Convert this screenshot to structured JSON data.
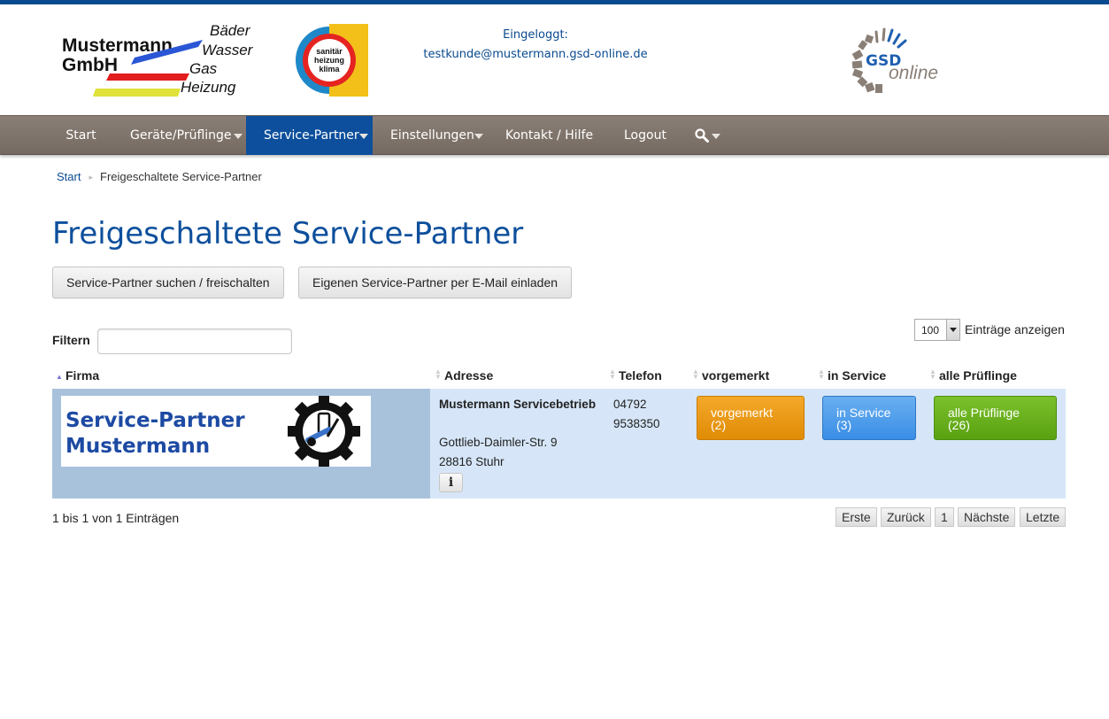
{
  "header": {
    "company_logo": {
      "name_line1": "Mustermann",
      "name_line2": "GmbH",
      "words": [
        "Bäder",
        "Wasser",
        "Gas",
        "Heizung"
      ]
    },
    "badge_logo": {
      "words": [
        "sanitär",
        "heizung",
        "klima"
      ]
    },
    "login_label": "Eingeloggt:",
    "login_email": "testkunde@mustermann.gsd-online.de",
    "gsd_logo": {
      "word1": "GSD",
      "word2": "online"
    }
  },
  "nav": {
    "items": [
      {
        "label": "Start",
        "dropdown": false
      },
      {
        "label": "Geräte/Prüflinge",
        "dropdown": true
      },
      {
        "label": "Service-Partner",
        "dropdown": true,
        "active": true
      },
      {
        "label": "Einstellungen",
        "dropdown": true
      },
      {
        "label": "Kontakt / Hilfe",
        "dropdown": false
      },
      {
        "label": "Logout",
        "dropdown": false
      }
    ],
    "search_icon": "search-icon"
  },
  "breadcrumb": {
    "home": "Start",
    "current": "Freigeschaltete Service-Partner"
  },
  "page_title": "Freigeschaltete Service-Partner",
  "actions": {
    "search_partner": "Service-Partner suchen / freischalten",
    "invite_partner": "Eigenen Service-Partner per E-Mail einladen"
  },
  "filter": {
    "label": "Filtern",
    "value": ""
  },
  "length": {
    "value": "100",
    "label": "Einträge anzeigen"
  },
  "table": {
    "columns": {
      "firma": "Firma",
      "adresse": "Adresse",
      "telefon": "Telefon",
      "vorgemerkt": "vorgemerkt",
      "in_service": "in Service",
      "alle": "alle Prüflinge"
    },
    "rows": [
      {
        "logo_line1": "Service-Partner",
        "logo_line2": "Mustermann",
        "name": "Mustermann Servicebetrieb",
        "street": "Gottlieb-Daimler-Str. 9",
        "city": "28816 Stuhr",
        "info_icon": "i",
        "phone_line1": "04792",
        "phone_line2": "9538350",
        "vorgemerkt_label": "vorgemerkt",
        "vorgemerkt_count": "(2)",
        "in_service_label": "in Service",
        "in_service_count": "(3)",
        "alle_label": "alle Prüflinge",
        "alle_count": "(26)"
      }
    ]
  },
  "table_info": "1 bis 1 von 1 Einträgen",
  "pagination": {
    "first": "Erste",
    "prev": "Zurück",
    "page": "1",
    "next": "Nächste",
    "last": "Letzte"
  },
  "colors": {
    "brand_blue": "#0d4f9c",
    "nav_bg": "#7f746b",
    "row_bg": "#d6e6f8",
    "firma_cell_bg": "#a9c2dc",
    "orange": "#e99a14",
    "blue": "#4d9cea",
    "green": "#66ad1b"
  }
}
